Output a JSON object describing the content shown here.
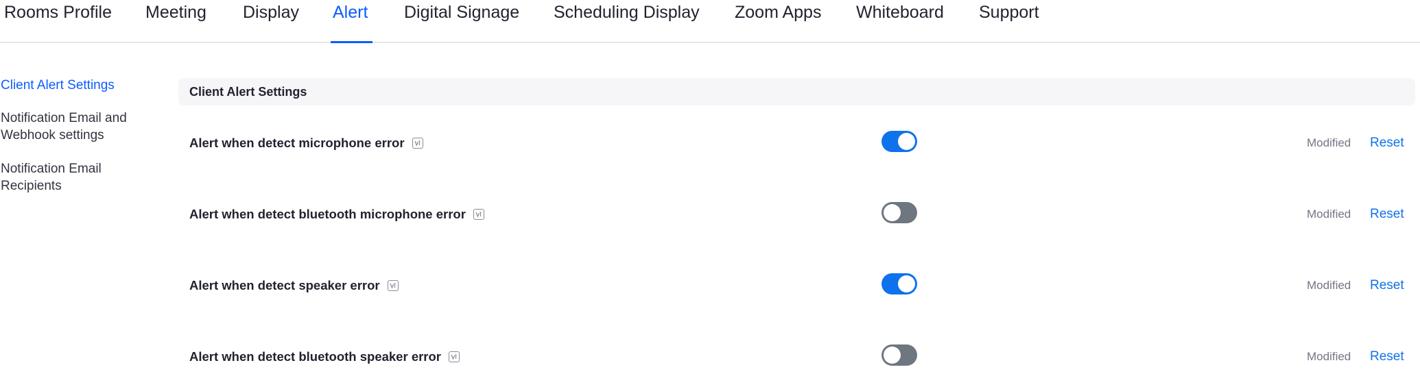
{
  "tabs": [
    {
      "label": "Rooms Profile",
      "active": false
    },
    {
      "label": "Meeting",
      "active": false
    },
    {
      "label": "Display",
      "active": false
    },
    {
      "label": "Alert",
      "active": true
    },
    {
      "label": "Digital Signage",
      "active": false
    },
    {
      "label": "Scheduling Display",
      "active": false
    },
    {
      "label": "Zoom Apps",
      "active": false
    },
    {
      "label": "Whiteboard",
      "active": false
    },
    {
      "label": "Support",
      "active": false
    }
  ],
  "sidebar": {
    "items": [
      {
        "label": "Client Alert Settings",
        "active": true
      },
      {
        "label": "Notification Email and Webhook settings",
        "active": false
      },
      {
        "label": "Notification Email Recipients",
        "active": false
      }
    ]
  },
  "section": {
    "title": "Client Alert Settings"
  },
  "settings": [
    {
      "label": "Alert when detect microphone error",
      "enabled": true,
      "status": "Modified",
      "action": "Reset"
    },
    {
      "label": "Alert when detect bluetooth microphone error",
      "enabled": false,
      "status": "Modified",
      "action": "Reset"
    },
    {
      "label": "Alert when detect speaker error",
      "enabled": true,
      "status": "Modified",
      "action": "Reset"
    },
    {
      "label": "Alert when detect bluetooth speaker error",
      "enabled": false,
      "status": "Modified",
      "action": "Reset"
    }
  ],
  "colors": {
    "accent": "#0b5cff",
    "toggle_on": "#0e72ed",
    "toggle_off": "#6e7680"
  },
  "icons": {
    "info": "info-icon"
  }
}
